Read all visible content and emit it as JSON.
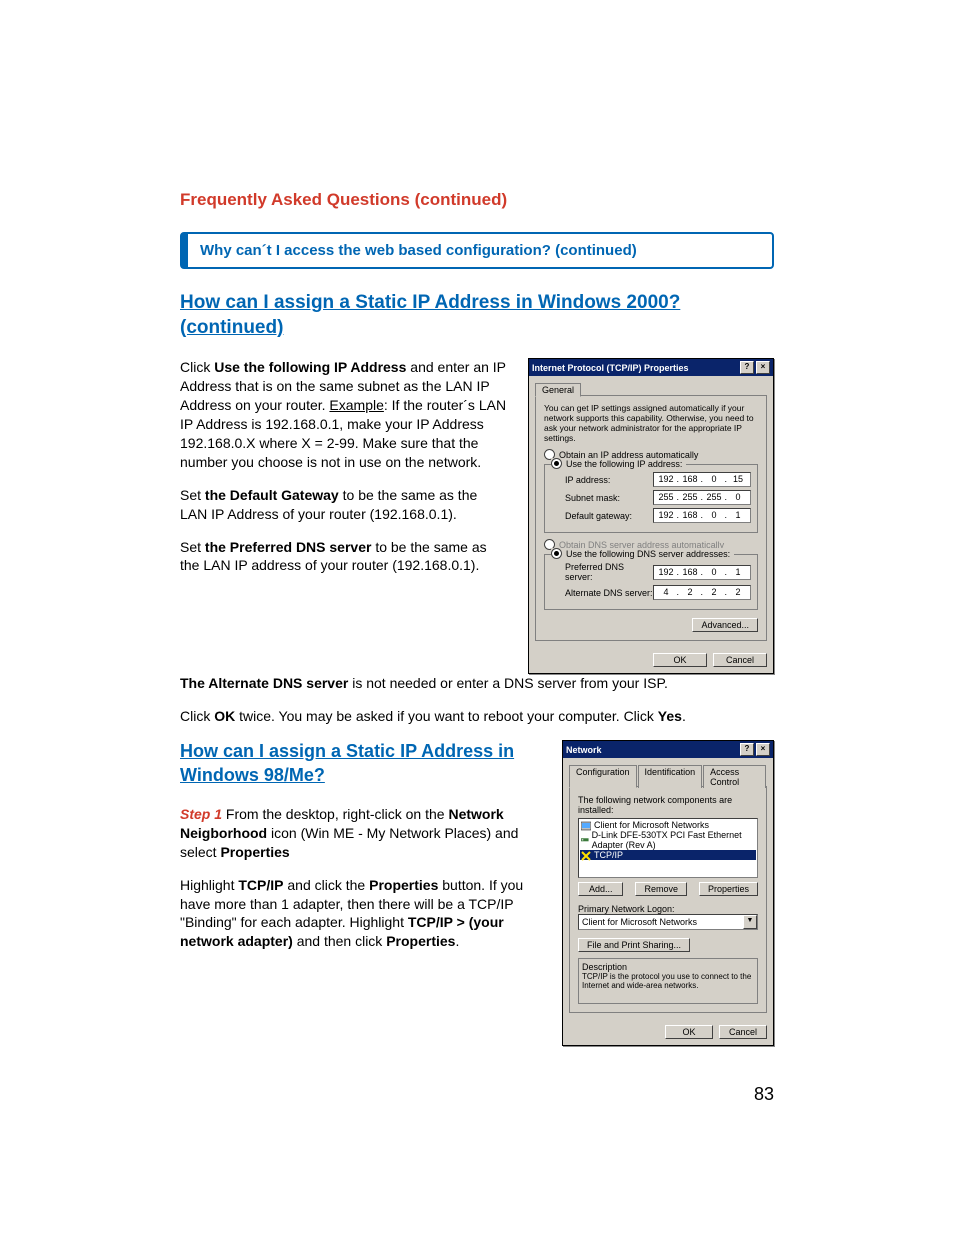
{
  "faq_title": "Frequently Asked Questions (continued)",
  "question_bar": "Why can´t I access the web based configuration? (continued)",
  "heading1": "How can I assign a Static IP Address in Windows 2000? (continued)",
  "para1": {
    "pre": "Click ",
    "b1": "Use the following IP Address",
    "mid": " and enter an IP Address that is on the same subnet as the LAN IP Address on your router. ",
    "ex_label": "Example",
    "ex_text": ": If the router´s LAN IP Address is 192.168.0.1, make your IP Address 192.168.0.X where X = 2-99. Make sure that the number you choose is not in use on the network."
  },
  "para2": {
    "pre": "Set ",
    "b": "the Default Gateway",
    "post": " to be the same as the LAN IP Address of your router (192.168.0.1)."
  },
  "para3": {
    "pre": "Set ",
    "b": "the Preferred DNS server",
    "post": " to be the same as the LAN IP address of your router (192.168.0.1)."
  },
  "para4": {
    "b": "The Alternate DNS server",
    "post": " is not needed or enter a DNS server from your ISP."
  },
  "para5": {
    "pre": "Click ",
    "b1": "OK",
    "mid": " twice. You may be asked if you want to reboot your computer. Click ",
    "b2": "Yes",
    "post": "."
  },
  "heading2": "How can I assign a Static IP Address in Windows 98/Me?",
  "para6": {
    "step": "Step 1",
    "pre": " From the desktop, right-click on the ",
    "b": "Network Neigborhood",
    "mid": " icon (Win ME - My Network Places) and select ",
    "b2": "Properties"
  },
  "para7": {
    "pre": "Highlight ",
    "b1": "TCP/IP",
    "mid1": " and click the ",
    "b2": "Properties",
    "mid2": " button. If you have more than 1 adapter, then there will be a TCP/IP \"Binding\" for each adapter. Highlight ",
    "b3": "TCP/IP > (your network adapter)",
    "mid3": " and then click ",
    "b4": "Properties",
    "post": "."
  },
  "page_number": "83",
  "dlg1": {
    "title": "Internet Protocol (TCP/IP) Properties",
    "tab": "General",
    "blurb": "You can get IP settings assigned automatically if your network supports this capability. Otherwise, you need to ask your network administrator for the appropriate IP settings.",
    "radio_auto_ip": "Obtain an IP address automatically",
    "radio_use_ip": "Use the following IP address:",
    "lbl_ip": "IP address:",
    "lbl_mask": "Subnet mask:",
    "lbl_gw": "Default gateway:",
    "radio_auto_dns": "Obtain DNS server address automatically",
    "radio_use_dns": "Use the following DNS server addresses:",
    "lbl_pref_dns": "Preferred DNS server:",
    "lbl_alt_dns": "Alternate DNS server:",
    "ip": [
      "192",
      "168",
      "0",
      "15"
    ],
    "mask": [
      "255",
      "255",
      "255",
      "0"
    ],
    "gw": [
      "192",
      "168",
      "0",
      "1"
    ],
    "pdns": [
      "192",
      "168",
      "0",
      "1"
    ],
    "adns": [
      "4",
      "2",
      "2",
      "2"
    ],
    "btn_adv": "Advanced...",
    "btn_ok": "OK",
    "btn_cancel": "Cancel"
  },
  "dlg2": {
    "title": "Network",
    "tabs": {
      "t1": "Configuration",
      "t2": "Identification",
      "t3": "Access Control"
    },
    "list_label": "The following network components are installed:",
    "items": {
      "i1": "Client for Microsoft Networks",
      "i2": "D-Link DFE-530TX PCI Fast Ethernet Adapter (Rev A)",
      "i3": "TCP/IP"
    },
    "btn_add": "Add...",
    "btn_remove": "Remove",
    "btn_props": "Properties",
    "logon_label": "Primary Network Logon:",
    "logon_value": "Client for Microsoft Networks",
    "btn_fps": "File and Print Sharing...",
    "desc_label": "Description",
    "desc_text": "TCP/IP is the protocol you use to connect to the Internet and wide-area networks.",
    "btn_ok": "OK",
    "btn_cancel": "Cancel"
  }
}
